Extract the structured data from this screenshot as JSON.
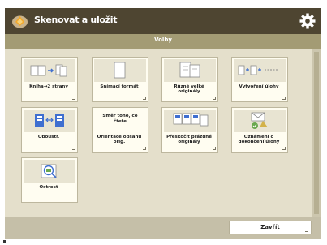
{
  "app": {
    "title": "Skenovat a uložit",
    "icon": "scan-store-icon",
    "settings_icon": "gear-icon"
  },
  "subheader": {
    "title": "Volby"
  },
  "tiles": [
    {
      "name": "tile-book-2-pages",
      "label": "Kniha→2 strany",
      "icon": "book-to-two-pages-icon"
    },
    {
      "name": "tile-orig-size",
      "label": "Snímací formát",
      "icon": "document-icon"
    },
    {
      "name": "tile-mixed-size",
      "label": "Různé velké originály",
      "icon": "mixed-size-originals-icon"
    },
    {
      "name": "tile-job-build",
      "label": "Vytvoření úlohy",
      "icon": "job-build-icon"
    },
    {
      "name": "tile-duplex",
      "label": "Oboustr.",
      "icon": "duplex-icon"
    },
    {
      "name": "tile-orig-orientation",
      "label": "Orientace obsahu orig.",
      "icon": "orientation-text-icon",
      "image_text": "Směr toho, co čtete"
    },
    {
      "name": "tile-multiple-originals",
      "label": "Přeskočit prázdné originály",
      "icon": "skip-blank-icon"
    },
    {
      "name": "tile-notify",
      "label": "Oznámení o dokončení úlohy",
      "icon": "notify-done-icon"
    },
    {
      "name": "tile-sharpness",
      "label": "Ostrost",
      "icon": "sharpness-icon"
    }
  ],
  "footer": {
    "close_label": "Zavřít"
  },
  "colors": {
    "titlebar": "#4e4531",
    "subheader": "#a39b74",
    "panel": "#e4dfcb",
    "accent_blue": "#3f6fd0"
  }
}
